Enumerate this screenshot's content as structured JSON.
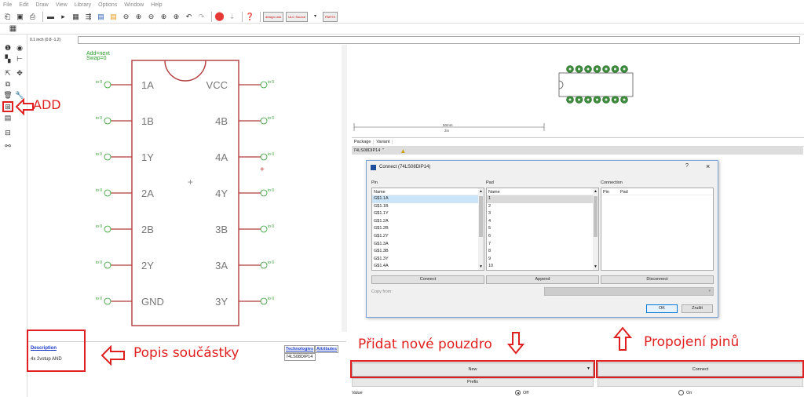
{
  "menu": [
    "File",
    "Edit",
    "Draw",
    "View",
    "Library",
    "Options",
    "Window",
    "Help"
  ],
  "toolbar": {
    "label_design_link": "design Link",
    "label_ulc_source": "ULC Source",
    "label_parts": "PARTS"
  },
  "coord": "0.1 inch (0.8 -1.2)",
  "symbol": {
    "attr_text": "Add=next\nSwap=0",
    "attr_line1": "Add=next",
    "attr_line2": "Swap=0",
    "pin_io": "io 0",
    "left_pins": [
      "1A",
      "1B",
      "1Y",
      "2A",
      "2B",
      "2Y",
      "GND"
    ],
    "right_pins": [
      "VCC",
      "4B",
      "4A",
      "4Y",
      "3B",
      "3A",
      "3Y"
    ]
  },
  "description": {
    "title": "Description",
    "text": "4x 2vstup AND"
  },
  "technologies": {
    "col1": "Technologies",
    "col2": "Attributes",
    "value": "74LS08DIP14"
  },
  "package_view": {
    "dim_mm": "50mm",
    "dim_in": "2in"
  },
  "package_table": {
    "columns": [
      "Package",
      "Variant"
    ],
    "row": {
      "package": "74LS08DIP14",
      "variant": "''"
    }
  },
  "dialog": {
    "title": "Connect  (74LS08DIP14)",
    "help": "?",
    "close": "×",
    "pin_header": "Pin",
    "pad_header": "Pad",
    "connection_header": "Connection",
    "name_col": "Name",
    "conn_pin_col": "Pin",
    "conn_pad_col": "Pad",
    "pins": [
      "G$1.1A",
      "G$1.1B",
      "G$1.1Y",
      "G$1.2A",
      "G$1.2B",
      "G$1.2Y",
      "G$1.3A",
      "G$1.3B",
      "G$1.3Y",
      "G$1.4A"
    ],
    "pads": [
      "1",
      "2",
      "3",
      "4",
      "5",
      "6",
      "7",
      "8",
      "9",
      "10"
    ],
    "connect_label": "Connect",
    "append_label": "Append",
    "disconnect_label": "Disconnect",
    "copy_from_label": "Copy from:",
    "ok_label": "OK",
    "cancel_label": "Zrušit"
  },
  "bottom": {
    "new_label": "New",
    "connect_label": "Connect",
    "prefix_label": "Prefix",
    "value_label": "Value",
    "off_label": "Off",
    "on_label": "On"
  },
  "annotations": {
    "add": "ADD",
    "popis": "Popis součástky",
    "pridat": "Přidat nové pouzdro",
    "propojeni": "Propojení pinů"
  },
  "colors": {
    "annotation_red": "#e02020",
    "symbol_body": "#b23a3a",
    "pin_green": "#2a9d2a",
    "pad_green": "#3c8c3c"
  }
}
